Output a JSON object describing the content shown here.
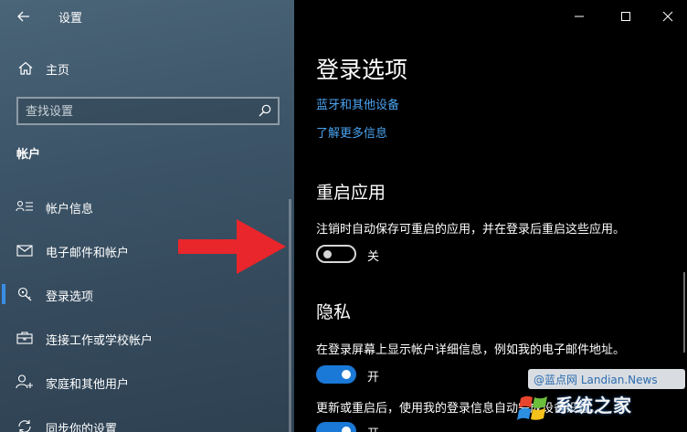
{
  "window": {
    "title": "设置",
    "controls": [
      "minimize-icon",
      "maximize-icon",
      "close-icon"
    ]
  },
  "sidebar": {
    "home_label": "主页",
    "search_placeholder": "查找设置",
    "section_title": "帐户",
    "items": [
      {
        "label": "帐户信息",
        "icon": "account-info-icon",
        "selected": false
      },
      {
        "label": "电子邮件和帐户",
        "icon": "mail-icon",
        "selected": false
      },
      {
        "label": "登录选项",
        "icon": "key-icon",
        "selected": true
      },
      {
        "label": "连接工作或学校帐户",
        "icon": "briefcase-icon",
        "selected": false
      },
      {
        "label": "家庭和其他用户",
        "icon": "add-user-icon",
        "selected": false
      },
      {
        "label": "同步你的设置",
        "icon": "sync-icon",
        "selected": false
      }
    ]
  },
  "main": {
    "page_title": "登录选项",
    "links": [
      "蓝牙和其他设备",
      "了解更多信息"
    ],
    "restart_apps": {
      "heading": "重启应用",
      "description": "注销时自动保存可重启的应用，并在登录后重启这些应用。",
      "toggle_on": false,
      "toggle_label": "关"
    },
    "privacy": {
      "heading": "隐私",
      "setting1": {
        "description": "在登录屏幕上显示帐户详细信息，例如我的电子邮件地址。",
        "toggle_on": true,
        "toggle_label": "开"
      },
      "setting2": {
        "description": "更新或重启后，使用我的登录信息自动完成设备设置。",
        "toggle_on": true,
        "toggle_label": "开"
      }
    }
  },
  "watermarks": [
    "@蓝点网 Landian.News",
    "系统之家"
  ],
  "colors": {
    "accent": "#1a78d6",
    "link": "#4aa3f0",
    "arrow": "#e8262b",
    "main_bg": "#000000"
  }
}
